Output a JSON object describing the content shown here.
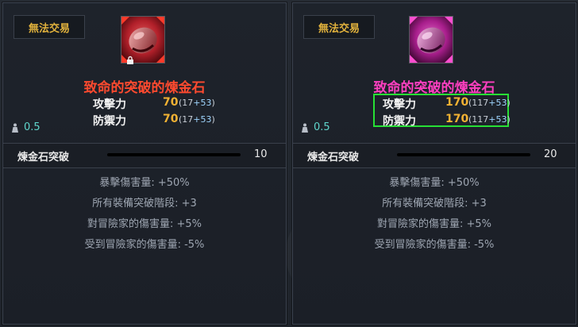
{
  "left": {
    "trade_tag": "無法交易",
    "item_name": "致命的突破的煉金石",
    "stats": [
      {
        "label": "攻擊力",
        "value": "70",
        "detail_pre": "(17",
        "detail_plus": "+53",
        "detail_post": ")"
      },
      {
        "label": "防禦力",
        "value": "70",
        "detail_pre": "(17",
        "detail_plus": "+53",
        "detail_post": ")"
      }
    ],
    "weight": "0.5",
    "break_label": "煉金石突破",
    "break_value": "10",
    "effects": [
      "暴擊傷害量: +50%",
      "所有裝備突破階段: +3",
      "對冒險家的傷害量: +5%",
      "受到冒險家的傷害量: -5%"
    ],
    "name_color": "#ff4a2f"
  },
  "right": {
    "trade_tag": "無法交易",
    "item_name": "致命的突破的煉金石",
    "stats": [
      {
        "label": "攻擊力",
        "value": "170",
        "detail_pre": "(117",
        "detail_plus": "+53",
        "detail_post": ")"
      },
      {
        "label": "防禦力",
        "value": "170",
        "detail_pre": "(117",
        "detail_plus": "+53",
        "detail_post": ")"
      }
    ],
    "weight": "0.5",
    "break_label": "煉金石突破",
    "break_value": "20",
    "effects": [
      "暴擊傷害量: +50%",
      "所有裝備突破階段: +3",
      "對冒險家的傷害量: +5%",
      "受到冒險家的傷害量: -5%"
    ],
    "name_color": "#ff3fc0",
    "highlight_color": "#27e035"
  },
  "icons": {
    "left_item": "red-alchemy-stone-icon",
    "right_item": "pink-alchemy-stone-icon",
    "weight": "weight-icon",
    "lock": "lock-icon"
  }
}
